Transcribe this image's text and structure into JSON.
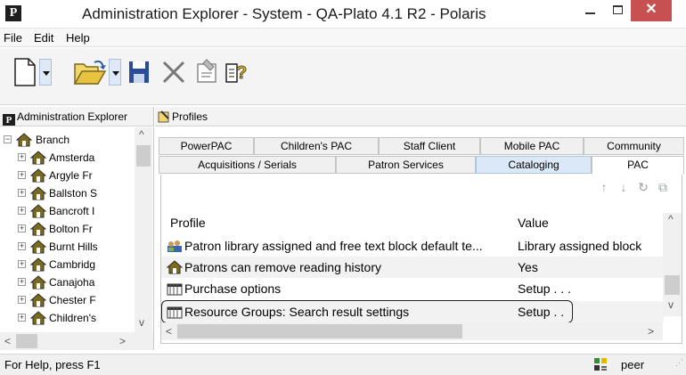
{
  "window": {
    "title": "Administration Explorer - System - QA-Plato 4.1 R2 - Polaris",
    "app_icon_letter": "P",
    "minimize_glyph": "",
    "close_glyph": "✕"
  },
  "menu": [
    "File",
    "Edit",
    "Help"
  ],
  "toolbar": {
    "buttons": [
      "new-document-icon",
      "open-folder-icon",
      "save-icon",
      "delete-icon",
      "properties-icon",
      "help-icon"
    ]
  },
  "left_pane": {
    "header": "Administration Explorer",
    "header_icon": "P",
    "tree_root": "Branch",
    "tree_root_toggle": "−",
    "tree_items": [
      "Amsterda",
      "Argyle Fr",
      "Ballston S",
      "Bancroft I",
      "Bolton Fr",
      "Burnt Hills",
      "Cambridg",
      "Canajoha",
      "Chester F",
      "Children's"
    ]
  },
  "right_pane": {
    "header": "Profiles",
    "tabs_row1": [
      "PowerPAC",
      "Children's PAC",
      "Staff Client",
      "Mobile PAC",
      "Community"
    ],
    "tabs_row2": [
      "Acquisitions / Serials",
      "Patron Services",
      "Cataloging",
      "PAC"
    ],
    "active_tab": "PAC",
    "hover_tab": "Cataloging",
    "actions": [
      "↑",
      "↓",
      "↻",
      "⧉"
    ],
    "columns": [
      "Profile",
      "Value"
    ],
    "rows": [
      {
        "profile": "Patron library assigned and free text block default te...",
        "value": "Library assigned block",
        "icon": "users-icon"
      },
      {
        "profile": "Patrons can remove reading history",
        "value": "Yes",
        "icon": "house-icon"
      },
      {
        "profile": "Purchase options",
        "value": "Setup . . .",
        "icon": "settings-panel-icon"
      },
      {
        "profile": "Resource Groups:  Search result settings",
        "value": "Setup . .",
        "icon": "settings-panel-icon"
      }
    ]
  },
  "status": {
    "text": "For Help, press F1",
    "user": "peer"
  },
  "colors": {
    "close_button": "#c75050",
    "hover_tab": "#dbe8f7",
    "house_icon": "#7a6a1f"
  }
}
